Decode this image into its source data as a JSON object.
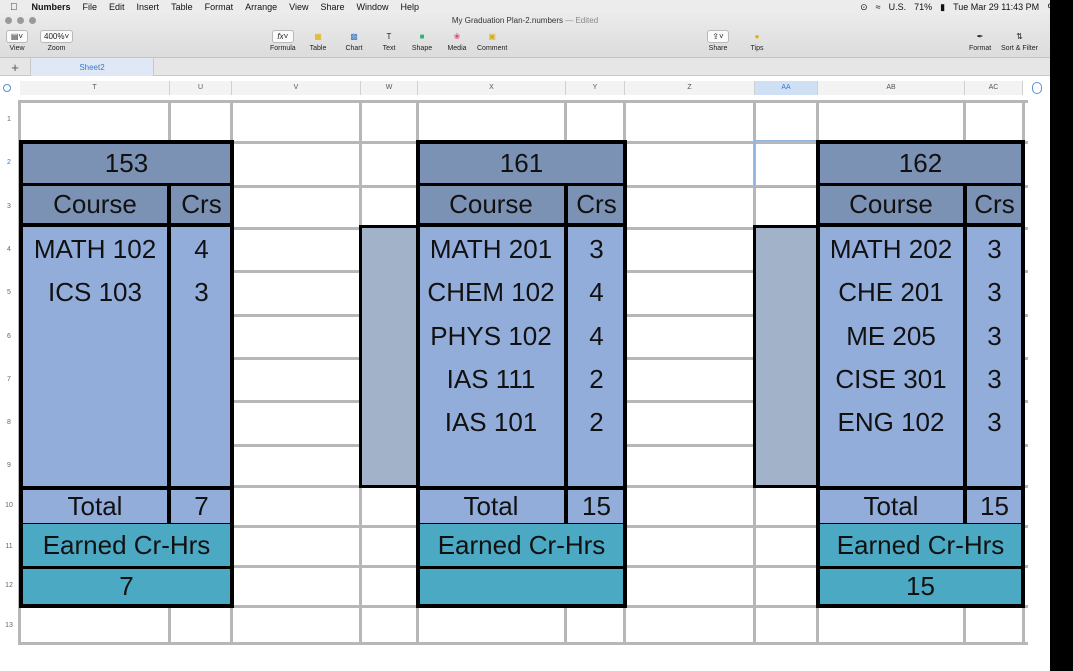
{
  "menubar": {
    "app": "Numbers",
    "items": [
      "File",
      "Edit",
      "Insert",
      "Table",
      "Format",
      "Arrange",
      "View",
      "Share",
      "Window",
      "Help"
    ],
    "status": {
      "input": "U.S.",
      "battery": "71%",
      "datetime": "Tue Mar 29  11:43 PM"
    }
  },
  "window": {
    "title": "My Graduation Plan-2.numbers",
    "edited": "— Edited"
  },
  "toolbar": {
    "view": "View",
    "zoom_value": "400%",
    "zoom": "Zoom",
    "formula": "Formula",
    "table": "Table",
    "chart": "Chart",
    "text": "Text",
    "shape": "Shape",
    "media": "Media",
    "comment": "Comment",
    "share": "Share",
    "tips": "Tips",
    "format": "Format",
    "sort_filter": "Sort & Filter"
  },
  "tabs": {
    "add": "+",
    "sheet": "Sheet2"
  },
  "columns": [
    "T",
    "U",
    "V",
    "W",
    "X",
    "Y",
    "Z",
    "AA",
    "AB",
    "AC"
  ],
  "rows": [
    "1",
    "2",
    "3",
    "4",
    "5",
    "6",
    "7",
    "8",
    "9",
    "10",
    "11",
    "12",
    "13"
  ],
  "semesters": [
    {
      "code": "153",
      "course_header": "Course",
      "crs_header": "Crs",
      "courses": [
        {
          "name": "MATH 102",
          "crs": "4"
        },
        {
          "name": "ICS 103",
          "crs": "3"
        }
      ],
      "total_label": "Total",
      "total": "7",
      "earned_label": "Earned Cr-Hrs",
      "earned": "7"
    },
    {
      "code": "161",
      "course_header": "Course",
      "crs_header": "Crs",
      "courses": [
        {
          "name": "MATH 201",
          "crs": "3"
        },
        {
          "name": "CHEM 102",
          "crs": "4"
        },
        {
          "name": "PHYS 102",
          "crs": "4"
        },
        {
          "name": "IAS 111",
          "crs": "2"
        },
        {
          "name": "IAS 101",
          "crs": "2"
        }
      ],
      "total_label": "Total",
      "total": "15",
      "earned_label": "Earned Cr-Hrs",
      "earned": ""
    },
    {
      "code": "162",
      "course_header": "Course",
      "crs_header": "Crs",
      "courses": [
        {
          "name": "MATH 202",
          "crs": "3"
        },
        {
          "name": "CHE 201",
          "crs": "3"
        },
        {
          "name": "ME 205",
          "crs": "3"
        },
        {
          "name": "CISE 301",
          "crs": "3"
        },
        {
          "name": "ENG 102",
          "crs": "3"
        }
      ],
      "total_label": "Total",
      "total": "15",
      "earned_label": "Earned Cr-Hrs",
      "earned": "15"
    }
  ]
}
